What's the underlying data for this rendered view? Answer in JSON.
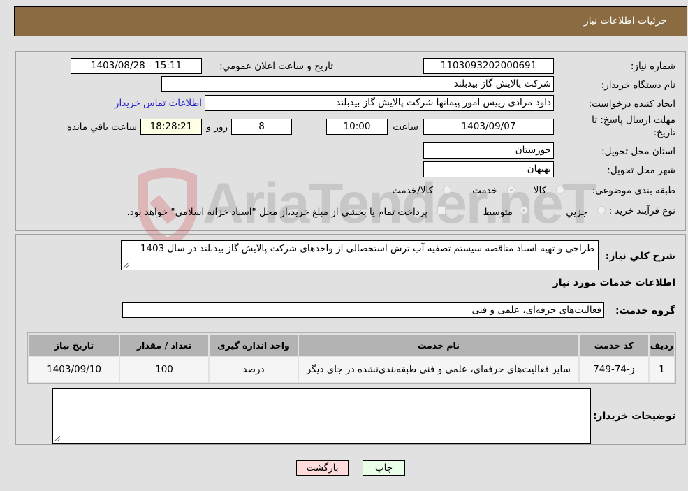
{
  "header": {
    "title": "جزئیات اطلاعات نیاز"
  },
  "form": {
    "need_number": {
      "label": "شماره نیاز:",
      "value": "1103093202000691"
    },
    "announce_datetime": {
      "label": "تاریخ و ساعت اعلان عمومي:",
      "value": "1403/08/28 - 15:11"
    },
    "buyer_org": {
      "label": "نام دستگاه خریدار:",
      "value": "شرکت پالایش گاز بیدبلند"
    },
    "requester": {
      "label": "ایجاد کننده درخواست:",
      "value": "داود مرادی رییس امور پیمانها شرکت پالایش گاز بیدبلند"
    },
    "buyer_contact_link": "اطلاعات تماس خریدار",
    "deadline": {
      "label": "مهلت ارسال پاسخ: تا تاریخ:",
      "date": "1403/09/07",
      "time_label": "ساعت",
      "time": "10:00",
      "days": "8",
      "days_label": "روز و",
      "remaining": "18:28:21",
      "remaining_label": "ساعت باقي مانده"
    },
    "province": {
      "label": "استان محل تحویل:",
      "value": "خوزستان"
    },
    "city": {
      "label": "شهر محل تحویل:",
      "value": "بهبهان"
    },
    "category": {
      "label": "طبقه بندی موضوعی:",
      "options": [
        "کالا",
        "خدمت",
        "کالا/خدمت"
      ],
      "selected": "خدمت"
    },
    "purchase_process": {
      "label": "نوع فرآیند خرید :",
      "options": [
        "جزیي",
        "متوسط"
      ],
      "selected": "متوسط",
      "treasury_note": "پرداخت تمام یا بخشی از مبلغ خرید،از محل \"اسناد خزانه اسلامی\" خواهد بود."
    }
  },
  "description": {
    "label": "شرح کلي نیاز:",
    "value": "طراحی و تهیه اسناد مناقصه سیستم تصفیه آب ترش استحصالی از واحدهای شرکت پالایش گاز بیدبلند در سال 1403"
  },
  "services": {
    "section_title": "اطلاعات خدمات مورد نیاز",
    "group_label": "گروه خدمت:",
    "group_value": "فعالیت‌های حرفه‌ای، علمی و فنی",
    "table": {
      "headers": [
        "ردیف",
        "کد خدمت",
        "نام خدمت",
        "واحد اندازه گیری",
        "تعداد / مقدار",
        "تاریخ نیاز"
      ],
      "rows": [
        [
          "1",
          "ز-74-749",
          "سایر فعالیت‌های حرفه‌ای، علمی و فنی طبقه‌بندی‌نشده در جای دیگر",
          "درصد",
          "100",
          "1403/09/10"
        ]
      ]
    }
  },
  "buyer_notes": {
    "label": "توضیحات خریدار:",
    "value": ""
  },
  "buttons": {
    "print": "چاپ",
    "back": "بازگشت"
  },
  "watermark": "AriaTender.neT",
  "colors": {
    "header_bg": "#8b6c42",
    "print_bg": "#eaffea",
    "back_bg": "#ffdcdc",
    "link": "#2323c9"
  }
}
